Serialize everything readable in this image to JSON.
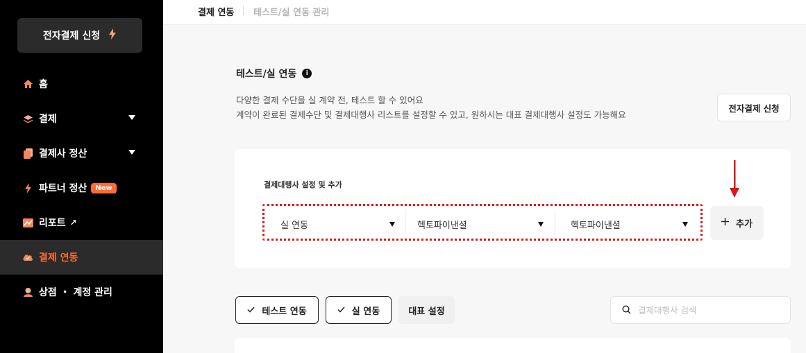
{
  "sidebar": {
    "apply_button": "전자결제 신청",
    "items": [
      {
        "label": "홈",
        "icon": "home-icon"
      },
      {
        "label": "결제",
        "icon": "layers-icon",
        "has_caret": true
      },
      {
        "label": "결제사 정산",
        "icon": "document-icon",
        "has_caret": true
      },
      {
        "label": "파트너 정산",
        "icon": "bolt-icon",
        "badge": "New"
      },
      {
        "label": "리포트",
        "icon": "chart-icon",
        "external": true
      },
      {
        "label": "결제 연동",
        "icon": "cloud-icon",
        "active": true
      },
      {
        "label": "상점 ・ 계정 관리",
        "icon": "shop-icon"
      }
    ]
  },
  "breadcrumb": {
    "active": "결제 연동",
    "inactive": "테스트/실 연동 관리"
  },
  "header": {
    "title": "테스트/실 연동",
    "desc1": "다양한 결제 수단을 실 계약 전, 테스트 할 수 있어요",
    "desc2": "계약이 완료된 결제수단 및 결제대행사 리스트를 설정할 수 있고, 원하시는 대표 결제대행사 설정도 가능해요",
    "apply_button": "전자결제 신청"
  },
  "pg_setting": {
    "label": "결제대행사 설정 및 추가",
    "mode": "실 연동",
    "pg": "헥토파이낸셜",
    "pg_sub": "헥토파이낸셜",
    "add_button": "추가"
  },
  "filters": {
    "test": "테스트 연동",
    "live": "실 연동",
    "representative": "대표 설정",
    "search_placeholder": "결제대행사 검색"
  },
  "colors": {
    "accent": "#ff6b35",
    "highlight": "#e01515",
    "sidebar_bg": "#000000"
  }
}
